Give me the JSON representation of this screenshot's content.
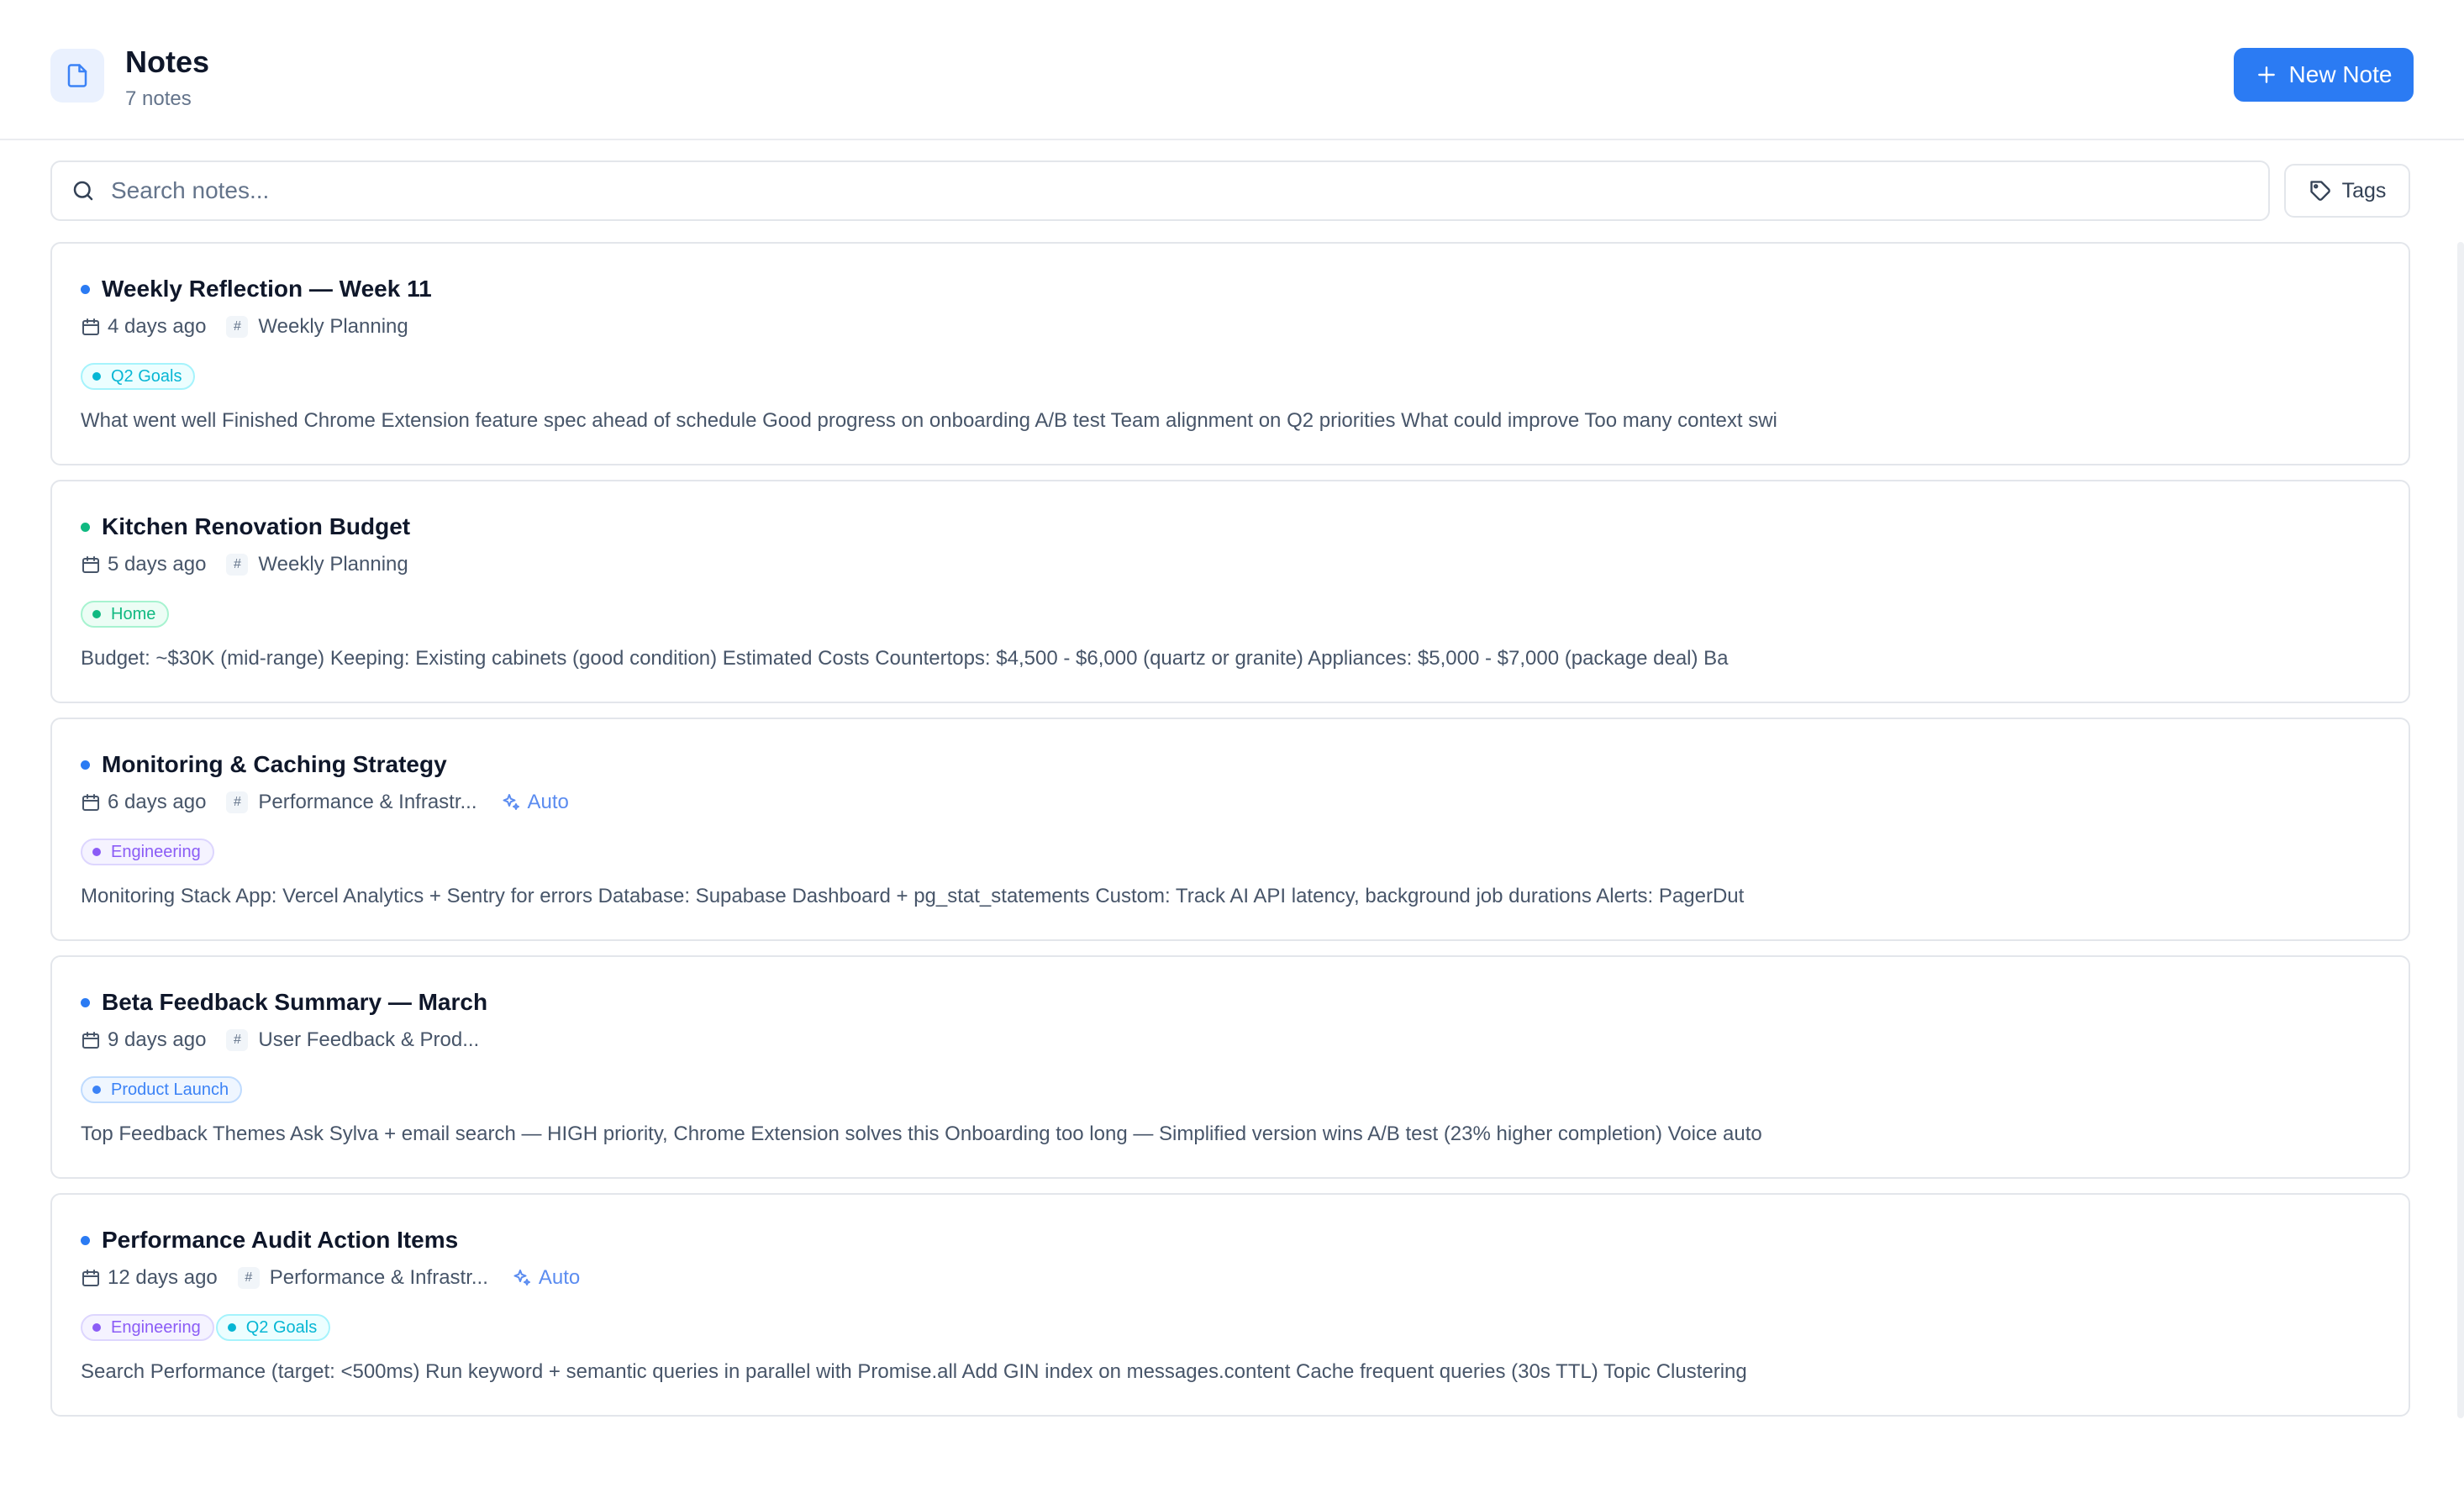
{
  "header": {
    "title": "Notes",
    "subtitle": "7 notes",
    "new_note_label": "New Note",
    "icon": "document-icon"
  },
  "search": {
    "placeholder": "Search notes...",
    "value": "",
    "tags_label": "Tags"
  },
  "notes": [
    {
      "title": "Weekly Reflection — Week 11",
      "dot_color": "#2b7bf3",
      "date": "4 days ago",
      "topic": "Weekly Planning",
      "auto": "",
      "tags": [
        {
          "label": "Q2 Goals",
          "color": "#06b6d4",
          "bg": "#ecfeff",
          "border": "#a5f3fc"
        }
      ],
      "preview": "What went well Finished Chrome Extension feature spec ahead of schedule Good progress on onboarding A/B test Team alignment on Q2 priorities What could improve Too many context swi"
    },
    {
      "title": "Kitchen Renovation Budget",
      "dot_color": "#10b981",
      "date": "5 days ago",
      "topic": "Weekly Planning",
      "auto": "",
      "tags": [
        {
          "label": "Home",
          "color": "#10b981",
          "bg": "#ecfdf5",
          "border": "#a7f3d0"
        }
      ],
      "preview": "Budget: ~$30K (mid-range) Keeping: Existing cabinets (good condition) Estimated Costs Countertops: $4,500 - $6,000 (quartz or granite) Appliances: $5,000 - $7,000 (package deal) Ba"
    },
    {
      "title": "Monitoring & Caching Strategy",
      "dot_color": "#2b7bf3",
      "date": "6 days ago",
      "topic": "Performance & Infrastr...",
      "auto": "Auto",
      "tags": [
        {
          "label": "Engineering",
          "color": "#8b5cf6",
          "bg": "#f5f3ff",
          "border": "#ddd6fe"
        }
      ],
      "preview": "Monitoring Stack App: Vercel Analytics + Sentry for errors Database: Supabase Dashboard + pg_stat_statements Custom: Track AI API latency, background job durations Alerts: PagerDut"
    },
    {
      "title": "Beta Feedback Summary — March",
      "dot_color": "#2b7bf3",
      "date": "9 days ago",
      "topic": "User Feedback & Prod...",
      "auto": "",
      "tags": [
        {
          "label": "Product Launch",
          "color": "#3b82f6",
          "bg": "#eff6ff",
          "border": "#bfdbfe"
        }
      ],
      "preview": "Top Feedback Themes Ask Sylva + email search — HIGH priority, Chrome Extension solves this Onboarding too long — Simplified version wins A/B test (23% higher completion) Voice auto"
    },
    {
      "title": "Performance Audit Action Items",
      "dot_color": "#2b7bf3",
      "date": "12 days ago",
      "topic": "Performance & Infrastr...",
      "auto": "Auto",
      "tags": [
        {
          "label": "Engineering",
          "color": "#8b5cf6",
          "bg": "#f5f3ff",
          "border": "#ddd6fe"
        },
        {
          "label": "Q2 Goals",
          "color": "#06b6d4",
          "bg": "#ecfeff",
          "border": "#a5f3fc"
        }
      ],
      "preview": "Search Performance (target: <500ms) Run keyword + semantic queries in parallel with Promise.all Add GIN index on messages.content Cache frequent queries (30s TTL) Topic Clustering"
    }
  ]
}
